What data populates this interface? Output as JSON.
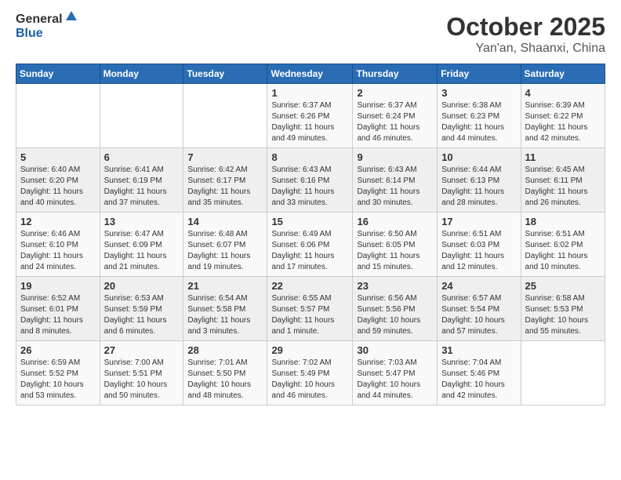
{
  "header": {
    "logo_general": "General",
    "logo_blue": "Blue",
    "month": "October 2025",
    "location": "Yan'an, Shaanxi, China"
  },
  "weekdays": [
    "Sunday",
    "Monday",
    "Tuesday",
    "Wednesday",
    "Thursday",
    "Friday",
    "Saturday"
  ],
  "weeks": [
    [
      {
        "day": "",
        "info": ""
      },
      {
        "day": "",
        "info": ""
      },
      {
        "day": "",
        "info": ""
      },
      {
        "day": "1",
        "info": "Sunrise: 6:37 AM\nSunset: 6:26 PM\nDaylight: 11 hours\nand 49 minutes."
      },
      {
        "day": "2",
        "info": "Sunrise: 6:37 AM\nSunset: 6:24 PM\nDaylight: 11 hours\nand 46 minutes."
      },
      {
        "day": "3",
        "info": "Sunrise: 6:38 AM\nSunset: 6:23 PM\nDaylight: 11 hours\nand 44 minutes."
      },
      {
        "day": "4",
        "info": "Sunrise: 6:39 AM\nSunset: 6:22 PM\nDaylight: 11 hours\nand 42 minutes."
      }
    ],
    [
      {
        "day": "5",
        "info": "Sunrise: 6:40 AM\nSunset: 6:20 PM\nDaylight: 11 hours\nand 40 minutes."
      },
      {
        "day": "6",
        "info": "Sunrise: 6:41 AM\nSunset: 6:19 PM\nDaylight: 11 hours\nand 37 minutes."
      },
      {
        "day": "7",
        "info": "Sunrise: 6:42 AM\nSunset: 6:17 PM\nDaylight: 11 hours\nand 35 minutes."
      },
      {
        "day": "8",
        "info": "Sunrise: 6:43 AM\nSunset: 6:16 PM\nDaylight: 11 hours\nand 33 minutes."
      },
      {
        "day": "9",
        "info": "Sunrise: 6:43 AM\nSunset: 6:14 PM\nDaylight: 11 hours\nand 30 minutes."
      },
      {
        "day": "10",
        "info": "Sunrise: 6:44 AM\nSunset: 6:13 PM\nDaylight: 11 hours\nand 28 minutes."
      },
      {
        "day": "11",
        "info": "Sunrise: 6:45 AM\nSunset: 6:11 PM\nDaylight: 11 hours\nand 26 minutes."
      }
    ],
    [
      {
        "day": "12",
        "info": "Sunrise: 6:46 AM\nSunset: 6:10 PM\nDaylight: 11 hours\nand 24 minutes."
      },
      {
        "day": "13",
        "info": "Sunrise: 6:47 AM\nSunset: 6:09 PM\nDaylight: 11 hours\nand 21 minutes."
      },
      {
        "day": "14",
        "info": "Sunrise: 6:48 AM\nSunset: 6:07 PM\nDaylight: 11 hours\nand 19 minutes."
      },
      {
        "day": "15",
        "info": "Sunrise: 6:49 AM\nSunset: 6:06 PM\nDaylight: 11 hours\nand 17 minutes."
      },
      {
        "day": "16",
        "info": "Sunrise: 6:50 AM\nSunset: 6:05 PM\nDaylight: 11 hours\nand 15 minutes."
      },
      {
        "day": "17",
        "info": "Sunrise: 6:51 AM\nSunset: 6:03 PM\nDaylight: 11 hours\nand 12 minutes."
      },
      {
        "day": "18",
        "info": "Sunrise: 6:51 AM\nSunset: 6:02 PM\nDaylight: 11 hours\nand 10 minutes."
      }
    ],
    [
      {
        "day": "19",
        "info": "Sunrise: 6:52 AM\nSunset: 6:01 PM\nDaylight: 11 hours\nand 8 minutes."
      },
      {
        "day": "20",
        "info": "Sunrise: 6:53 AM\nSunset: 5:59 PM\nDaylight: 11 hours\nand 6 minutes."
      },
      {
        "day": "21",
        "info": "Sunrise: 6:54 AM\nSunset: 5:58 PM\nDaylight: 11 hours\nand 3 minutes."
      },
      {
        "day": "22",
        "info": "Sunrise: 6:55 AM\nSunset: 5:57 PM\nDaylight: 11 hours\nand 1 minute."
      },
      {
        "day": "23",
        "info": "Sunrise: 6:56 AM\nSunset: 5:56 PM\nDaylight: 10 hours\nand 59 minutes."
      },
      {
        "day": "24",
        "info": "Sunrise: 6:57 AM\nSunset: 5:54 PM\nDaylight: 10 hours\nand 57 minutes."
      },
      {
        "day": "25",
        "info": "Sunrise: 6:58 AM\nSunset: 5:53 PM\nDaylight: 10 hours\nand 55 minutes."
      }
    ],
    [
      {
        "day": "26",
        "info": "Sunrise: 6:59 AM\nSunset: 5:52 PM\nDaylight: 10 hours\nand 53 minutes."
      },
      {
        "day": "27",
        "info": "Sunrise: 7:00 AM\nSunset: 5:51 PM\nDaylight: 10 hours\nand 50 minutes."
      },
      {
        "day": "28",
        "info": "Sunrise: 7:01 AM\nSunset: 5:50 PM\nDaylight: 10 hours\nand 48 minutes."
      },
      {
        "day": "29",
        "info": "Sunrise: 7:02 AM\nSunset: 5:49 PM\nDaylight: 10 hours\nand 46 minutes."
      },
      {
        "day": "30",
        "info": "Sunrise: 7:03 AM\nSunset: 5:47 PM\nDaylight: 10 hours\nand 44 minutes."
      },
      {
        "day": "31",
        "info": "Sunrise: 7:04 AM\nSunset: 5:46 PM\nDaylight: 10 hours\nand 42 minutes."
      },
      {
        "day": "",
        "info": ""
      }
    ]
  ]
}
